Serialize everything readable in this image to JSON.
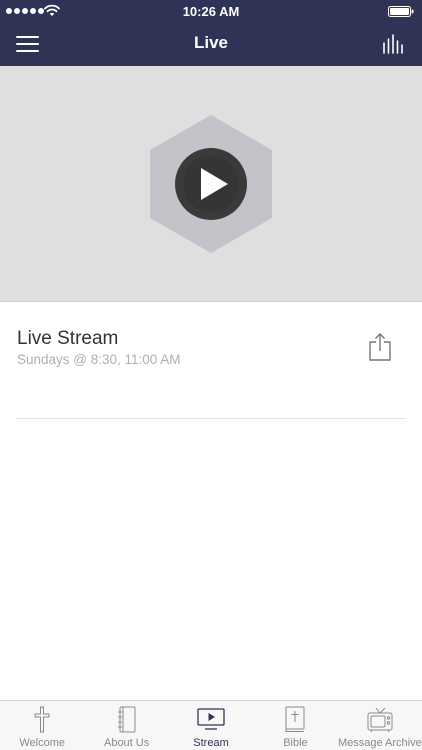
{
  "status_bar": {
    "time": "10:26 AM",
    "signal_icon": "signal-dots-icon",
    "wifi_icon": "wifi-icon",
    "battery_icon": "battery-icon"
  },
  "nav": {
    "title": "Live",
    "menu_icon": "hamburger-menu-icon",
    "right_icon": "equalizer-icon"
  },
  "colors": {
    "header_bg": "#2f3456",
    "video_bg": "#dfdfdf",
    "hexagon": "#c3c4c9",
    "play_circle": "#3a3a3a",
    "tab_active": "#2f3456",
    "tab_inactive": "#8a8a8a"
  },
  "video": {
    "icon": "play-icon"
  },
  "stream": {
    "title": "Live Stream",
    "subtitle": "Sundays @ 8:30, 11:00 AM",
    "share_icon": "share-icon"
  },
  "tabs": [
    {
      "label": "Welcome",
      "icon": "cross-icon",
      "active": false
    },
    {
      "label": "About Us",
      "icon": "notebook-icon",
      "active": false
    },
    {
      "label": "Stream",
      "icon": "tv-play-icon",
      "active": true
    },
    {
      "label": "Bible",
      "icon": "bible-icon",
      "active": false
    },
    {
      "label": "Message Archive",
      "icon": "retro-tv-icon",
      "active": false
    }
  ]
}
